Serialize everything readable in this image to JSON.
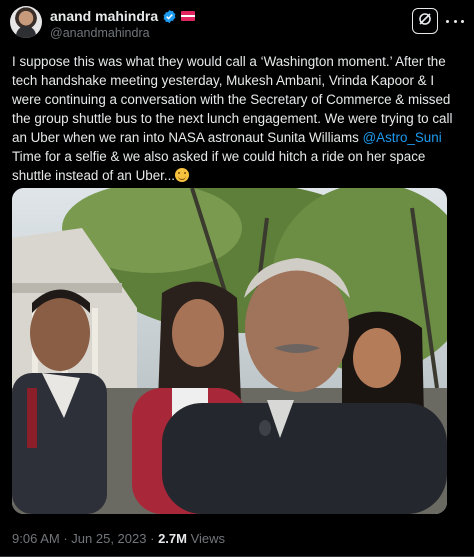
{
  "author": {
    "display_name": "anand mahindra",
    "handle": "@anandmahindra",
    "verified": true,
    "verified_color": "#1d9bf0"
  },
  "post": {
    "text_lines": [
      "I suppose this was what they would call a ‘Washington moment.’  After the",
      "tech handshake meeting yesterday, Mukesh Ambani, Vrinda Kapoor & I",
      "were continuing a conversation with the Secretary of Commerce & missed",
      "the group shuttle bus to the next lunch engagement. We were trying to call",
      "an Uber when we ran into NASA astronaut Sunita Williams",
      "Time for a selfie & we also asked if we could hitch a ride on her space",
      "shuttle instead of an Uber..."
    ],
    "mention": "@Astro_Suni",
    "mention_color": "#1d9bf0",
    "emoji": "smiling-face-emoji"
  },
  "meta": {
    "time": "9:06 AM",
    "separator": "·",
    "date": "Jun 25, 2023",
    "views_count": "2.7M",
    "views_label": "Views"
  },
  "colors": {
    "background": "#000000",
    "text_primary": "#e7e9ea",
    "text_secondary": "#71767b"
  }
}
